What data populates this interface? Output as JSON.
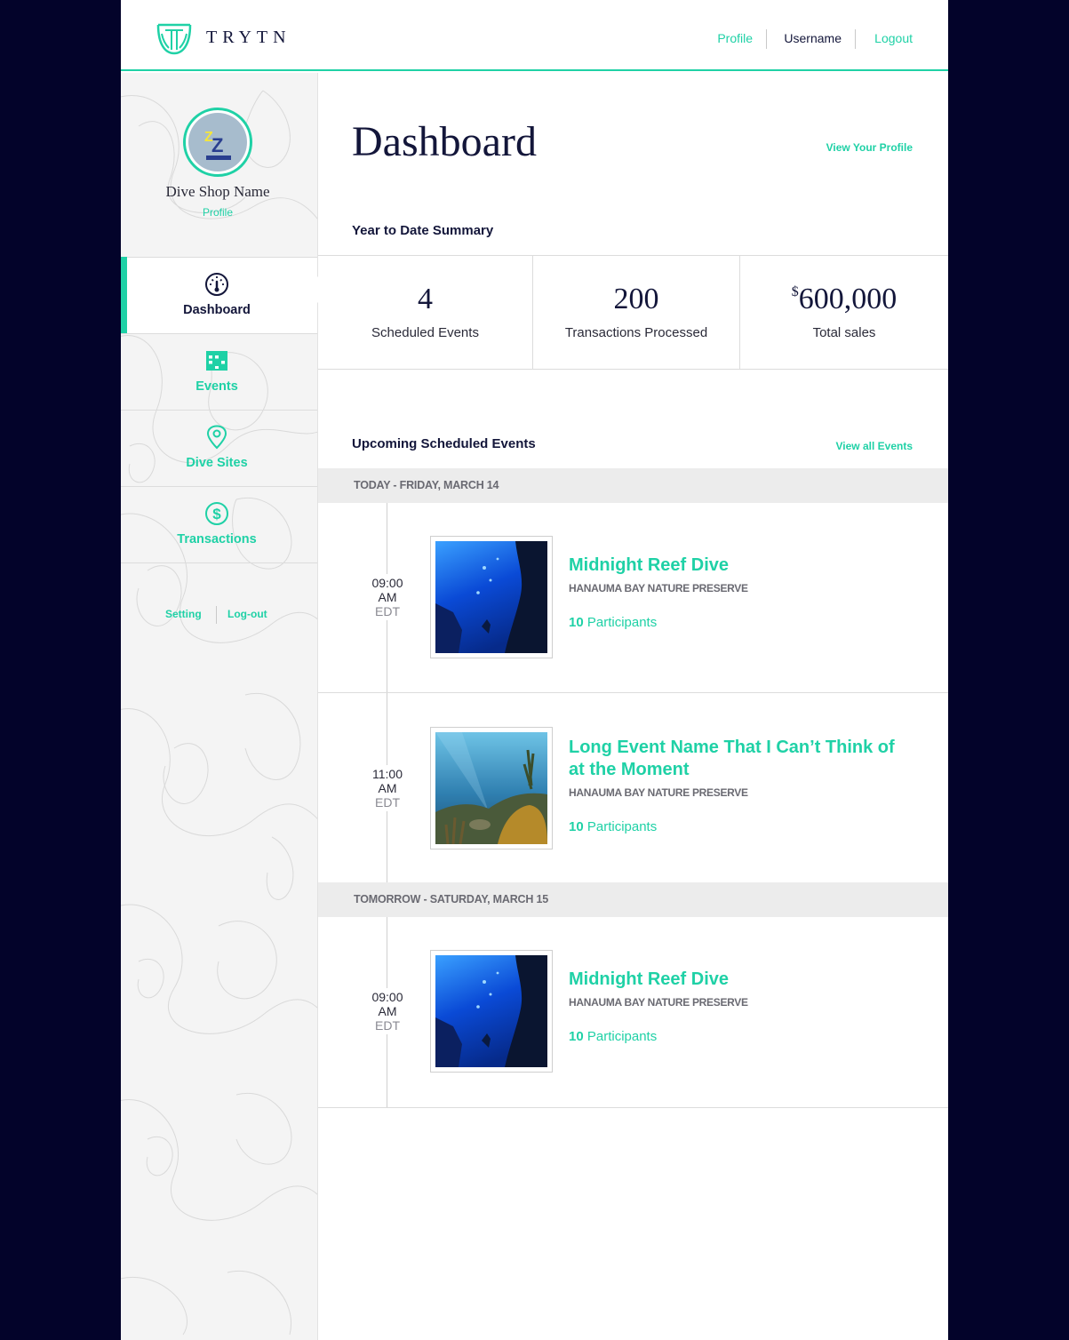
{
  "header": {
    "brand": "TRYTN",
    "links": {
      "profile": "Profile",
      "username": "Username",
      "logout": "Logout"
    }
  },
  "sidebar": {
    "shop_name": "Dive Shop Name",
    "profile_link": "Profile",
    "nav": [
      {
        "label": "Dashboard",
        "icon": "gauge-icon",
        "active": true
      },
      {
        "label": "Events",
        "icon": "calendar-icon",
        "active": false
      },
      {
        "label": "Dive Sites",
        "icon": "map-pin-icon",
        "active": false
      },
      {
        "label": "Transactions",
        "icon": "dollar-circle-icon",
        "active": false
      }
    ],
    "footer_links": {
      "setting": "Setting",
      "logout": "Log-out"
    }
  },
  "main": {
    "title": "Dashboard",
    "view_profile": "View Your Profile",
    "ytd_heading": "Year to Date Summary",
    "stats": [
      {
        "prefix": "",
        "value": "4",
        "label": "Scheduled Events"
      },
      {
        "prefix": "",
        "value": "200",
        "label": "Transactions Processed"
      },
      {
        "prefix": "$",
        "value": "600,000",
        "label": "Total sales"
      }
    ],
    "upcoming_heading": "Upcoming Scheduled Events",
    "view_all": "View all Events",
    "days": [
      {
        "heading": "TODAY - FRIDAY, MARCH 14",
        "events": [
          {
            "time": "09:00",
            "ampm": "AM",
            "tz": "EDT",
            "name": "Midnight Reef Dive",
            "site": "HANAUMA BAY NATURE PRESERVE",
            "participants_count": "10",
            "participants_label": "Participants"
          },
          {
            "time": "11:00",
            "ampm": "AM",
            "tz": "EDT",
            "name": "Long Event Name That I Can’t Think of at the Moment",
            "site": "HANAUMA BAY NATURE PRESERVE",
            "participants_count": "10",
            "participants_label": "Participants"
          }
        ]
      },
      {
        "heading": "TOMORROW - SATURDAY, MARCH 15",
        "events": [
          {
            "time": "09:00",
            "ampm": "AM",
            "tz": "EDT",
            "name": "Midnight Reef Dive",
            "site": "HANAUMA BAY NATURE PRESERVE",
            "participants_count": "10",
            "participants_label": "Participants"
          }
        ]
      }
    ]
  },
  "colors": {
    "accent": "#1fd1a6",
    "navy": "#13163a",
    "backdrop": "#03032a"
  }
}
